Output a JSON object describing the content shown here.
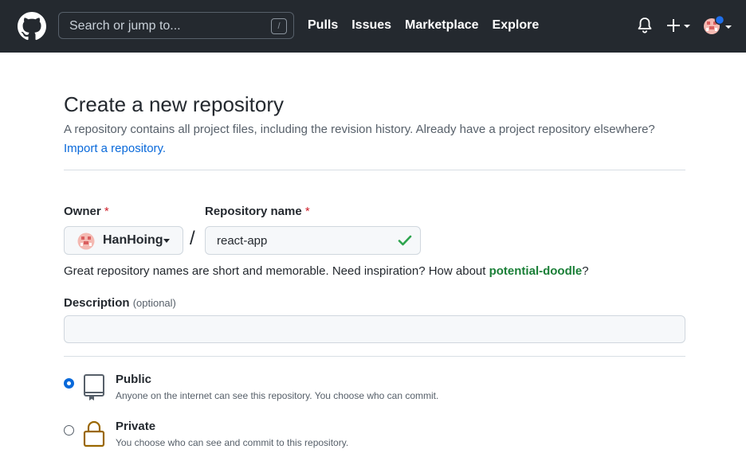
{
  "header": {
    "search_placeholder": "Search or jump to...",
    "search_shortcut": "/",
    "nav": [
      "Pulls",
      "Issues",
      "Marketplace",
      "Explore"
    ]
  },
  "page": {
    "title": "Create a new repository",
    "subtitle": "A repository contains all project files, including the revision history. Already have a project repository elsewhere?",
    "import_link": "Import a repository."
  },
  "form": {
    "owner_label": "Owner",
    "required_mark": "*",
    "owner_value": "HanHoing",
    "separator": "/",
    "repo_label": "Repository name",
    "repo_value": "react-app",
    "hint_prefix": "Great repository names are short and memorable. Need inspiration? How about ",
    "hint_suggestion": "potential-doodle",
    "hint_suffix": "?",
    "description_label": "Description",
    "description_optional": "(optional)",
    "description_value": ""
  },
  "visibility": [
    {
      "title": "Public",
      "desc": "Anyone on the internet can see this repository. You choose who can commit.",
      "checked": true
    },
    {
      "title": "Private",
      "desc": "You choose who can see and commit to this repository.",
      "checked": false
    }
  ],
  "colors": {
    "header_bg": "#24292f",
    "link": "#0969da",
    "success": "#1a7f37",
    "required": "#cf222e",
    "private_icon": "#9a6700"
  }
}
